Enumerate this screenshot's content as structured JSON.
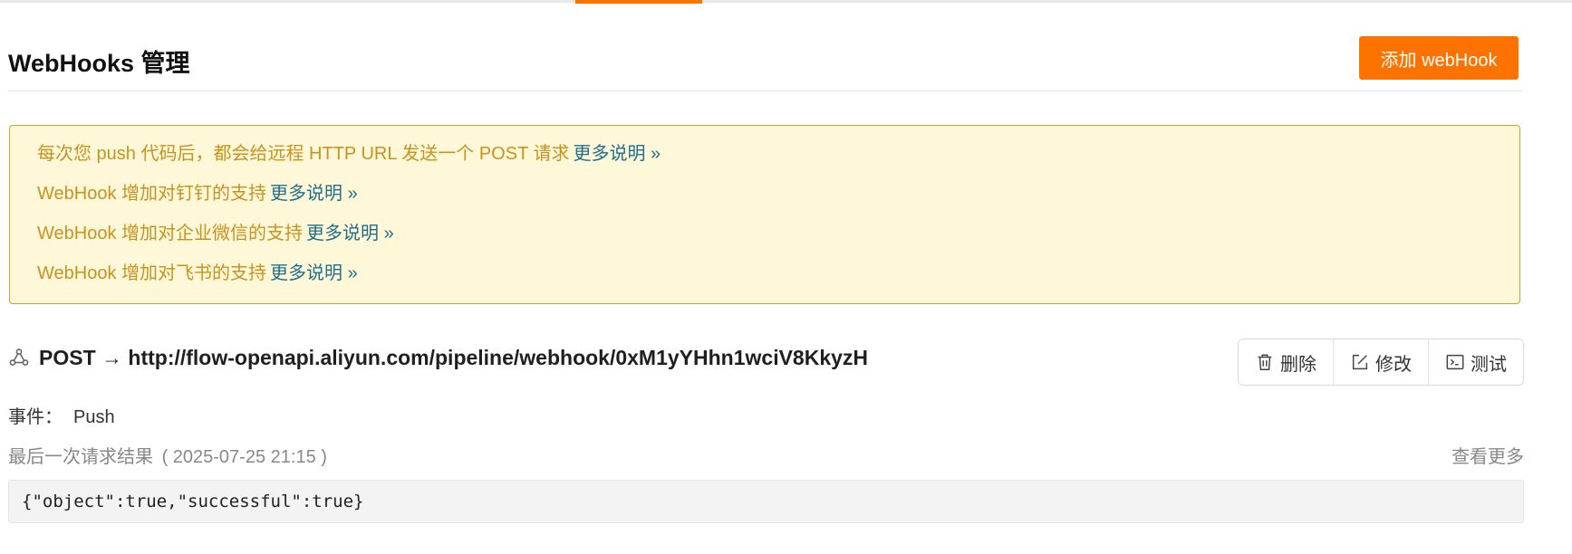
{
  "header": {
    "title": "WebHooks 管理",
    "add_button": "添加 webHook"
  },
  "notice": {
    "lines": [
      {
        "text": "每次您 push 代码后，都会给远程 HTTP URL 发送一个 POST 请求",
        "link": "更多说明 »"
      },
      {
        "text": "WebHook 增加对钉钉的支持",
        "link": "更多说明 »"
      },
      {
        "text": "WebHook 增加对企业微信的支持",
        "link": "更多说明 »"
      },
      {
        "text": "WebHook 增加对飞书的支持",
        "link": "更多说明 »"
      }
    ]
  },
  "hook": {
    "icon": "webhook-icon",
    "title": "POST → http://flow-openapi.aliyun.com/pipeline/webhook/0xM1yYHhn1wciV8KkyzH",
    "actions": {
      "delete": "删除",
      "edit": "修改",
      "test": "测试"
    },
    "event_label": "事件：",
    "event_value": "Push",
    "result_label": "最后一次请求结果",
    "result_time": "( 2025-07-25 21:15 )",
    "see_more": "查看更多",
    "response": "{\"object\":true,\"successful\":true}"
  },
  "colors": {
    "accent": "#fe7300",
    "notice_bg": "#fff8d8",
    "notice_text": "#c7931e",
    "notice_link": "#1e6f8a"
  }
}
